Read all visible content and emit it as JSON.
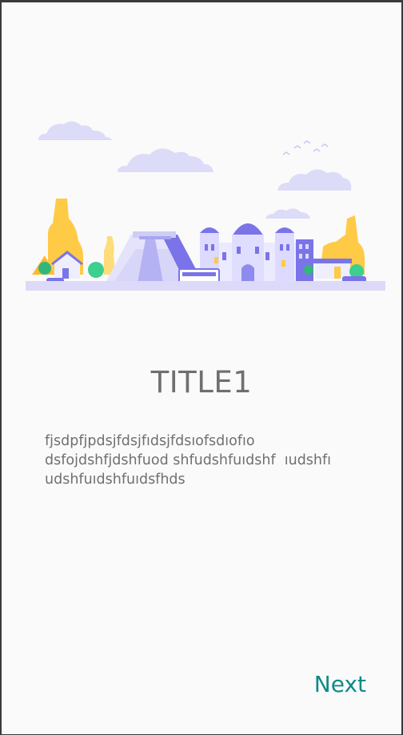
{
  "onboarding": {
    "title": "TITLE1",
    "description": "fjsdpfjpdsjfdsjfıdsjfdsıofsdıofıo\ndsfojdshfjdshfuod shfudshfuıdshf  ıudshfı\nudshfuıdshfuıdsfhds",
    "next_label": "Next"
  },
  "colors": {
    "title": "#6f6f6f",
    "text": "#707070",
    "accent": "#0f8a8a",
    "background": "#fafafa"
  },
  "icons": {
    "hero": "city-landmarks-illustration"
  }
}
